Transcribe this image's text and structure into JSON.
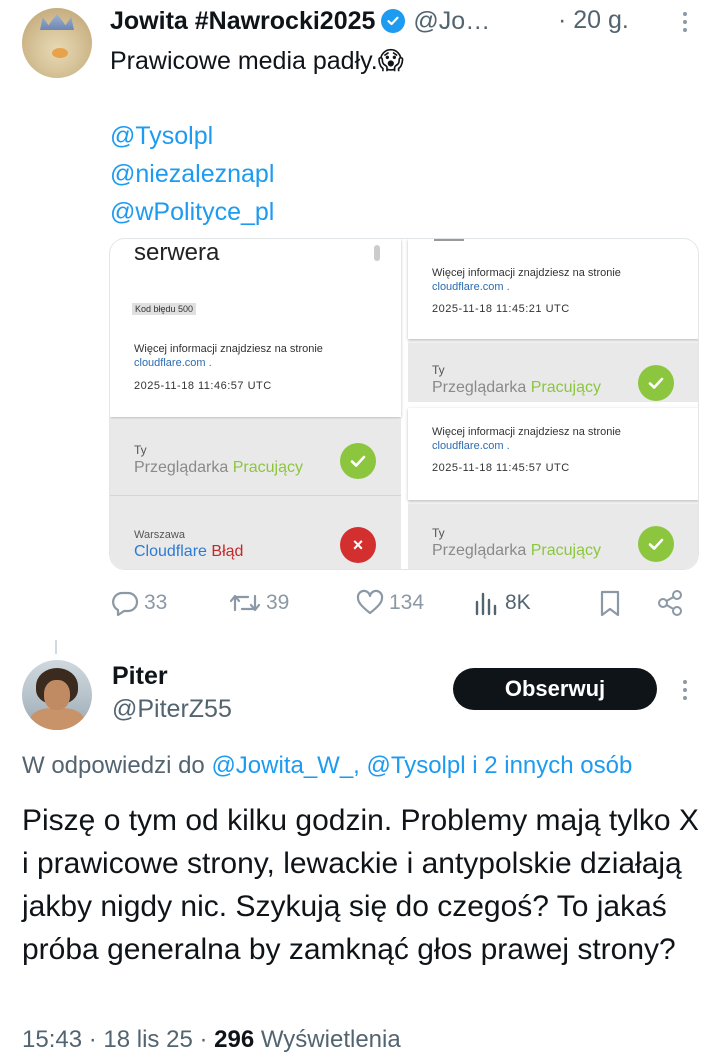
{
  "tweet": {
    "author_name": "Jowita #Nawrocki2025",
    "author_handle": "@Jo…",
    "time_ago": "· 20 g.",
    "text": "Prawicowe media padły.😱",
    "mentions": [
      "@Tysolpl",
      "@niezaleznapl",
      "@wPolityce_pl"
    ],
    "media": {
      "left": {
        "heading": "serwera",
        "error_code": "Kod błędu 500",
        "info_text": "Więcej informacji znajdziesz na stronie",
        "link": "cloudflare.com .",
        "timestamp": "2025-11-18 11:46:57 UTC",
        "you_label": "Ty",
        "browser_label": "Przeglądarka",
        "browser_status": "Pracujący",
        "location_label": "Warszawa",
        "cloudflare_label": "Cloudflare",
        "cloudflare_status": "Błąd"
      },
      "right_top": {
        "info_text": "Więcej informacji znajdziesz na stronie",
        "link": "cloudflare.com .",
        "timestamp": "2025-11-18 11:45:21 UTC",
        "you_label": "Ty",
        "browser_label": "Przeglądarka",
        "browser_status": "Pracujący"
      },
      "right_bottom": {
        "info_text": "Więcej informacji znajdziesz na stronie",
        "link": "cloudflare.com .",
        "timestamp": "2025-11-18 11:45:57 UTC",
        "you_label": "Ty",
        "browser_label": "Przeglądarka",
        "browser_status": "Pracujący"
      }
    },
    "actions": {
      "replies": "33",
      "reposts": "39",
      "likes": "134",
      "views": "8K"
    }
  },
  "reply": {
    "author_name": "Piter",
    "author_handle": "@PiterZ55",
    "follow_label": "Obserwuj",
    "reply_prefix": "W odpowiedzi do ",
    "reply_targets": "@Jowita_W_, @Tysolpl i 2 innych osób",
    "text": "Piszę o tym od kilku godzin. Problemy mają tylko X i prawicowe strony, lewackie i antypolskie działają jakby nigdy nic. Szykują się do czegoś? To jakaś próba generalna by zamknąć głos prawej strony?",
    "time": "15:43",
    "date": "18 lis 25",
    "views_count": "296",
    "views_label": "Wyświetlenia"
  },
  "colors": {
    "accent": "#1d9bf0",
    "ok_green": "#8cc63f",
    "error_red": "#d32f2f",
    "muted": "#536471"
  }
}
